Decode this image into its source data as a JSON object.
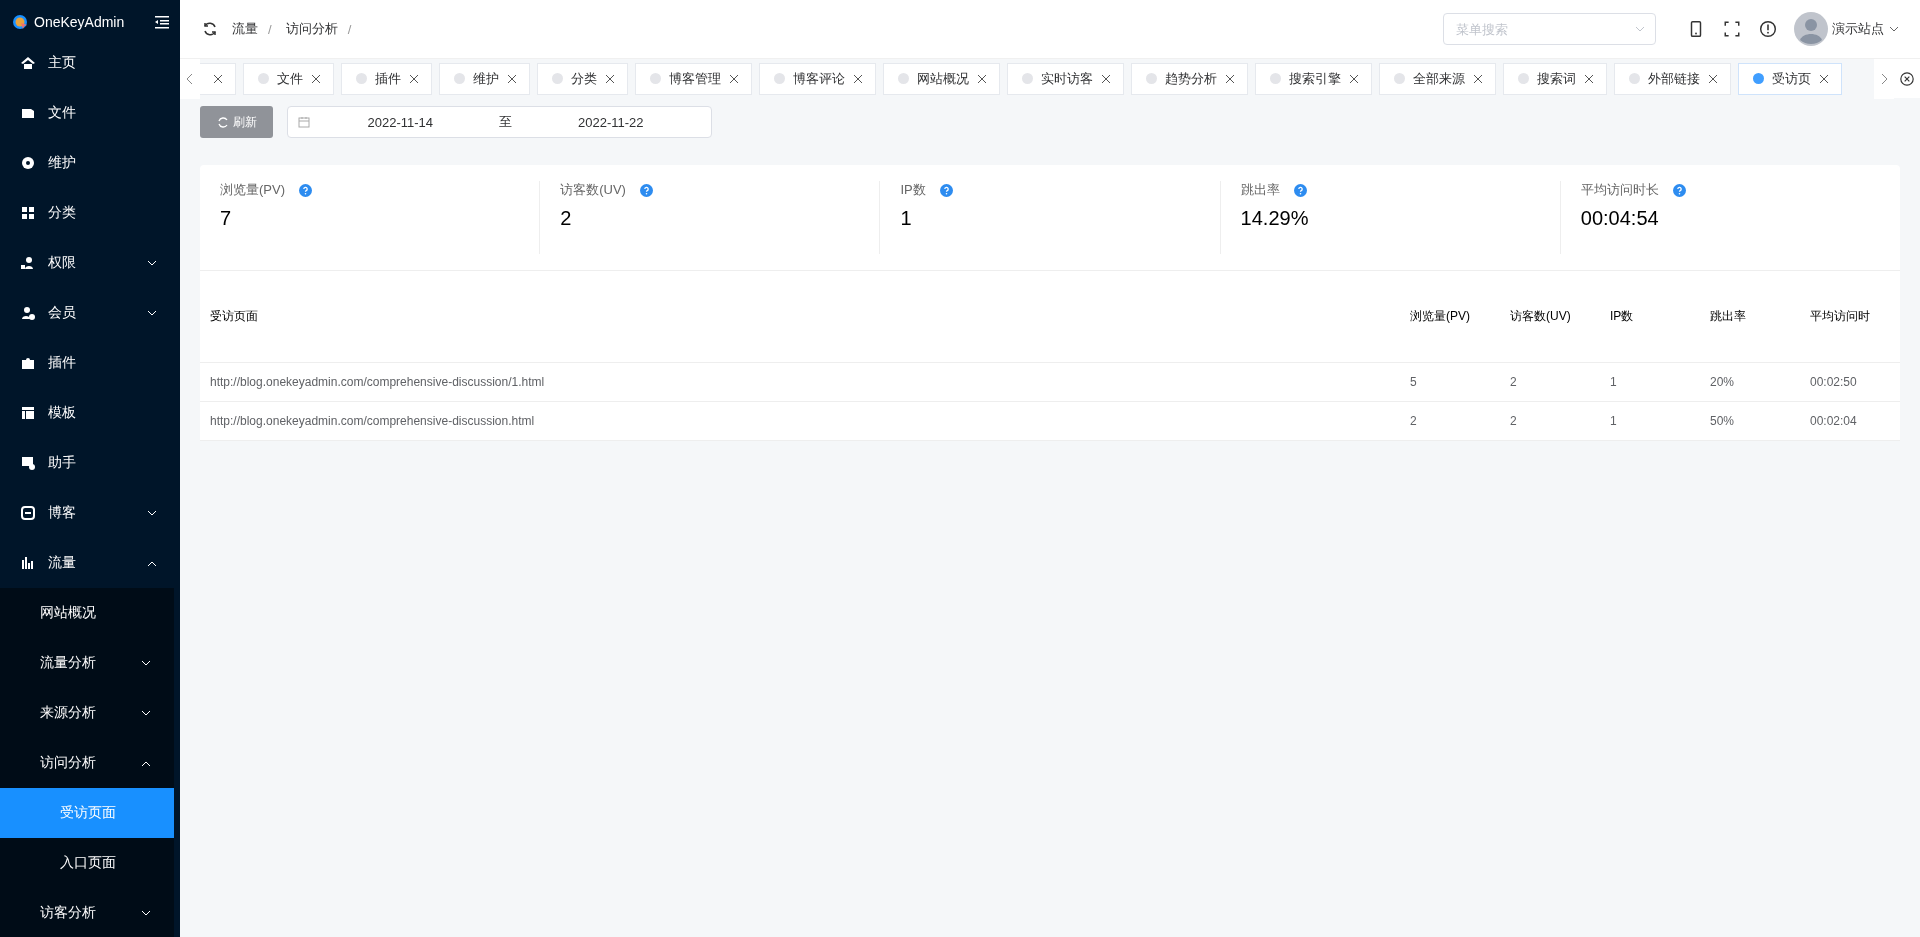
{
  "sidebar": {
    "logo": "OneKeyAdmin",
    "items": [
      {
        "label": "主页",
        "selected": false
      },
      {
        "label": "文件",
        "selected": false
      },
      {
        "label": "维护",
        "selected": false
      },
      {
        "label": "分类",
        "selected": false
      },
      {
        "label": "权限",
        "selected": false,
        "expanded": false
      },
      {
        "label": "会员",
        "selected": false,
        "expanded": false
      },
      {
        "label": "插件",
        "selected": false
      },
      {
        "label": "模板",
        "selected": false
      },
      {
        "label": "助手",
        "selected": false
      },
      {
        "label": "博客",
        "selected": false,
        "expanded": false
      },
      {
        "label": "流量",
        "selected": false,
        "expanded": true,
        "children": [
          {
            "label": "网站概况",
            "selected": false
          },
          {
            "label": "流量分析",
            "selected": false,
            "expanded": false
          },
          {
            "label": "来源分析",
            "selected": false,
            "expanded": false
          },
          {
            "label": "访问分析",
            "selected": false,
            "expanded": true,
            "children": [
              {
                "label": "受访页面",
                "selected": true
              },
              {
                "label": "入口页面",
                "selected": false
              }
            ]
          },
          {
            "label": "访客分析",
            "selected": false,
            "expanded": false
          }
        ]
      }
    ]
  },
  "header": {
    "breadcrumb": {
      "items": [
        "流量",
        "访问分析"
      ],
      "separator": "/"
    },
    "search": {
      "placeholder": "菜单搜索"
    },
    "user": "演示站点"
  },
  "tabs": [
    {
      "selected": false
    },
    {
      "label": "文件",
      "selected": false
    },
    {
      "label": "插件",
      "selected": false
    },
    {
      "label": "维护",
      "selected": false
    },
    {
      "label": "分类",
      "selected": false
    },
    {
      "label": "博客管理",
      "selected": false
    },
    {
      "label": "博客评论",
      "selected": false
    },
    {
      "label": "网站概况",
      "selected": false
    },
    {
      "label": "实时访客",
      "selected": false
    },
    {
      "label": "趋势分析",
      "selected": false
    },
    {
      "label": "搜索引擎",
      "selected": false
    },
    {
      "label": "全部来源",
      "selected": false
    },
    {
      "label": "搜索词",
      "selected": false
    },
    {
      "label": "外部链接",
      "selected": false
    },
    {
      "label": "受访页",
      "selected": true
    }
  ],
  "toolbar": {
    "refresh": "刷新",
    "date_range": {
      "start": "2022-11-14",
      "separator": "至",
      "end": "2022-11-22"
    }
  },
  "stats": [
    {
      "label": "浏览量(PV)",
      "value": "7"
    },
    {
      "label": "访客数(UV)",
      "value": "2"
    },
    {
      "label": "IP数",
      "value": "1"
    },
    {
      "label": "跳出率",
      "value": "14.29%"
    },
    {
      "label": "平均访问时长",
      "value": "00:04:54"
    }
  ],
  "table": {
    "columns": [
      "受访页面",
      "浏览量(PV)",
      "访客数(UV)",
      "IP数",
      "跳出率",
      "平均访问时"
    ],
    "rows": [
      [
        "http://blog.onekeyadmin.com/comprehensive-discussion/1.html",
        "5",
        "2",
        "1",
        "20%",
        "00:02:50"
      ],
      [
        "http://blog.onekeyadmin.com/comprehensive-discussion.html",
        "2",
        "2",
        "1",
        "50%",
        "00:02:04"
      ]
    ]
  }
}
